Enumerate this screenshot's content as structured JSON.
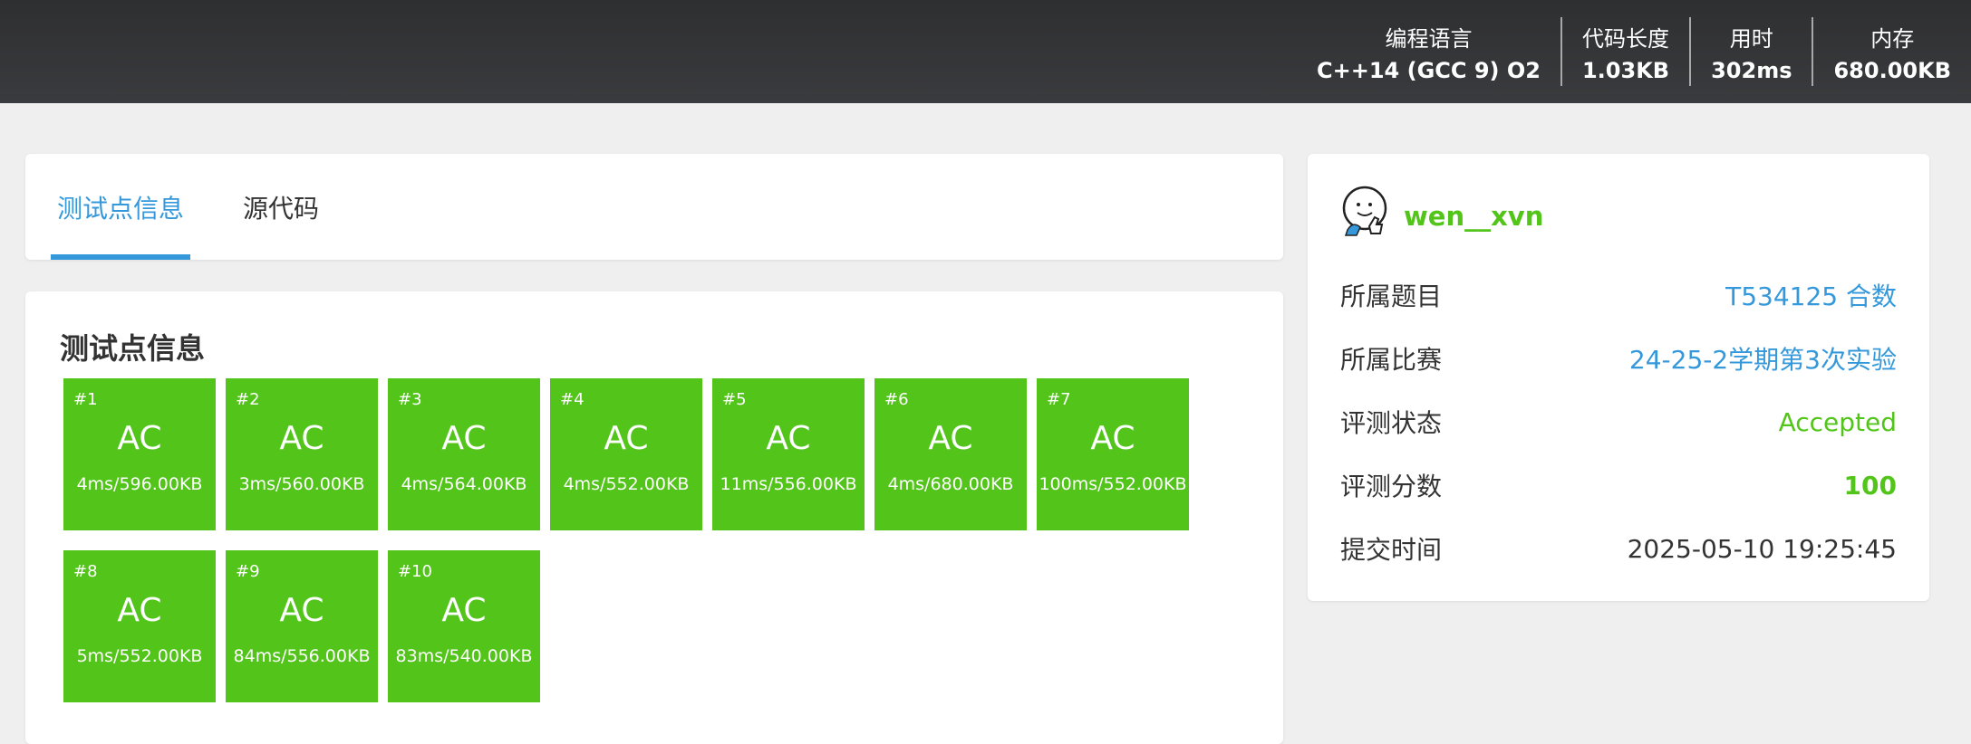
{
  "stats": [
    {
      "label": "编程语言",
      "value": "C++14 (GCC 9) O2"
    },
    {
      "label": "代码长度",
      "value": "1.03KB"
    },
    {
      "label": "用时",
      "value": "302ms"
    },
    {
      "label": "内存",
      "value": "680.00KB"
    }
  ],
  "tabs": [
    {
      "label": "测试点信息"
    },
    {
      "label": "源代码"
    }
  ],
  "section": {
    "title": "测试点信息"
  },
  "testcases": [
    {
      "num": "#1",
      "result": "AC",
      "time_mem": "4ms/596.00KB"
    },
    {
      "num": "#2",
      "result": "AC",
      "time_mem": "3ms/560.00KB"
    },
    {
      "num": "#3",
      "result": "AC",
      "time_mem": "4ms/564.00KB"
    },
    {
      "num": "#4",
      "result": "AC",
      "time_mem": "4ms/552.00KB"
    },
    {
      "num": "#5",
      "result": "AC",
      "time_mem": "11ms/556.00KB"
    },
    {
      "num": "#6",
      "result": "AC",
      "time_mem": "4ms/680.00KB"
    },
    {
      "num": "#7",
      "result": "AC",
      "time_mem": "100ms/552.00KB"
    },
    {
      "num": "#8",
      "result": "AC",
      "time_mem": "5ms/552.00KB"
    },
    {
      "num": "#9",
      "result": "AC",
      "time_mem": "84ms/556.00KB"
    },
    {
      "num": "#10",
      "result": "AC",
      "time_mem": "83ms/540.00KB"
    }
  ],
  "info": {
    "username": "wen__xvn",
    "rows": [
      {
        "key": "所属题目",
        "value": "T534125 合数"
      },
      {
        "key": "所属比赛",
        "value": "24-25-2学期第3次实验"
      },
      {
        "key": "评测状态",
        "value": "Accepted"
      },
      {
        "key": "评测分数",
        "value": "100"
      },
      {
        "key": "提交时间",
        "value": "2025-05-10 19:25:45"
      }
    ]
  },
  "colors": {
    "accent": "#3498db",
    "success": "#52c41a",
    "header": "#2e2f31"
  }
}
